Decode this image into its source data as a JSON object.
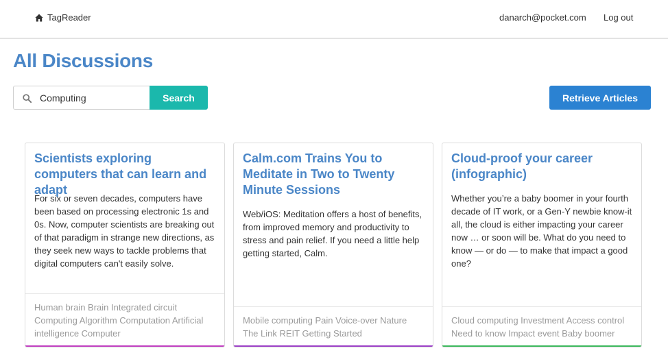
{
  "nav": {
    "brand": "TagReader",
    "brand_icon": "home-icon",
    "email": "danarch@pocket.com",
    "logout": "Log out"
  },
  "page": {
    "title": "All Discussions"
  },
  "search": {
    "value": "Computing",
    "icon": "search-icon",
    "button_label": "Search",
    "button_color": "#1bb8ac"
  },
  "retrieve": {
    "label": "Retrieve Articles",
    "color": "#2b82d2"
  },
  "cards": [
    {
      "title": "Scientists exploring computers that can learn and adapt",
      "description": "For six or seven decades, computers have been based on processing electronic 1s and 0s. Now, computer scientists are breaking out of that paradigm in strange new directions, as they seek new ways to tackle problems that digital computers can't easily solve.",
      "tags": "Human brain Brain Integrated circuit Computing Algorithm Computation Artificial intelligence Computer",
      "accent": "#c03ec0"
    },
    {
      "title": "Calm.com Trains You to Meditate in Two to Twenty Minute Sessions",
      "description": "Web/iOS: Meditation offers a host of benefits, from improved memory and productivity to stress and pain relief. If you need a little help getting started, Calm.",
      "tags": "Mobile computing Pain Voice-over Nature The Link REIT Getting Started",
      "accent": "#9b3fc6"
    },
    {
      "title": "Cloud-proof your career (infographic)",
      "description": "Whether you’re a baby boomer in your fourth decade of IT work, or a Gen-Y newbie know-it all, the cloud is either impacting your career now … or soon will be. What do you need to know — or do — to make that impact a good one?",
      "tags": "Cloud computing Investment Access control Need to know Impact event Baby boomer",
      "accent": "#3cb85c"
    }
  ]
}
